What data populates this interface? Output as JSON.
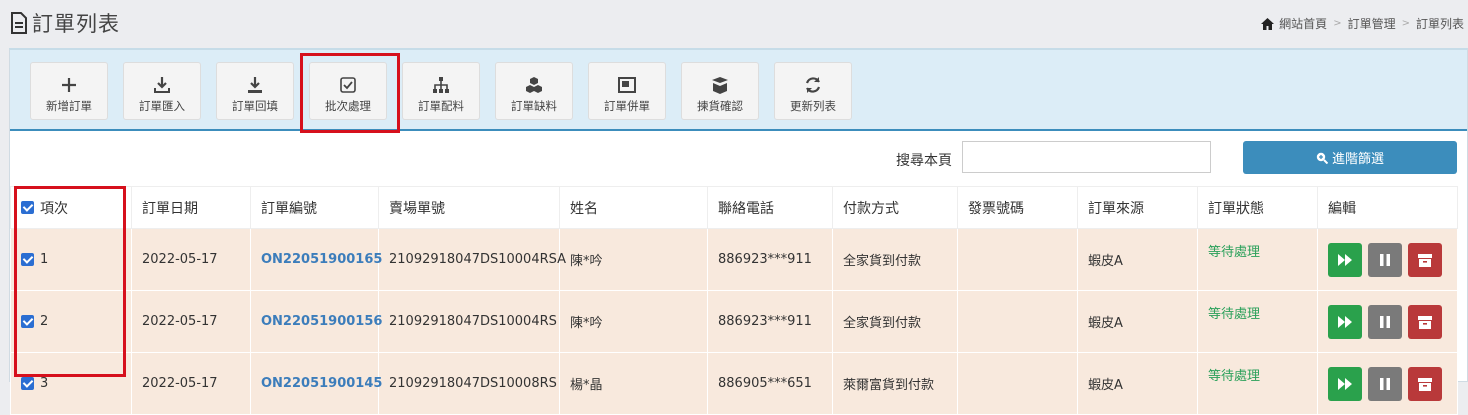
{
  "header": {
    "title": "訂單列表",
    "breadcrumb": [
      "網站首頁",
      "訂單管理",
      "訂單列表"
    ]
  },
  "toolbar": {
    "buttons": [
      {
        "label": "新增訂單",
        "icon": "plus-icon"
      },
      {
        "label": "訂單匯入",
        "icon": "download-tray-icon"
      },
      {
        "label": "訂單回填",
        "icon": "download-icon"
      },
      {
        "label": "批次處理",
        "icon": "checkbox-icon"
      },
      {
        "label": "訂單配料",
        "icon": "sitemap-icon"
      },
      {
        "label": "訂單缺料",
        "icon": "cubes-icon"
      },
      {
        "label": "訂單併單",
        "icon": "merge-window-icon"
      },
      {
        "label": "揀貨確認",
        "icon": "open-box-icon"
      },
      {
        "label": "更新列表",
        "icon": "refresh-icon"
      }
    ]
  },
  "search": {
    "label": "搜尋本頁",
    "value": "",
    "advanced_label": "進階篩選"
  },
  "table": {
    "headers": [
      "項次",
      "訂單日期",
      "訂單編號",
      "賣場單號",
      "姓名",
      "聯絡電話",
      "付款方式",
      "發票號碼",
      "訂單來源",
      "訂單狀態",
      "編輯"
    ],
    "rows": [
      {
        "no": "1",
        "date": "2022-05-17",
        "order": "ON22051900165",
        "shop": "21092918047DS10004RSA",
        "name": "陳*吟",
        "phone": "886923***911",
        "pay": "全家貨到付款",
        "invoice": "",
        "source": "蝦皮A",
        "status": "等待處理"
      },
      {
        "no": "2",
        "date": "2022-05-17",
        "order": "ON22051900156",
        "shop": "21092918047DS10004RS",
        "name": "陳*吟",
        "phone": "886923***911",
        "pay": "全家貨到付款",
        "invoice": "",
        "source": "蝦皮A",
        "status": "等待處理"
      },
      {
        "no": "3",
        "date": "2022-05-17",
        "order": "ON22051900145",
        "shop": "21092918047DS10008RS",
        "name": "楊*晶",
        "phone": "886905***651",
        "pay": "萊爾富貨到付款",
        "invoice": "",
        "source": "蝦皮A",
        "status": "等待處理"
      }
    ]
  },
  "colors": {
    "accent": "#3c8dbc",
    "highlight": "#d6101c",
    "row_bg": "#f8e9dd",
    "status_green": "#2aa05a"
  }
}
